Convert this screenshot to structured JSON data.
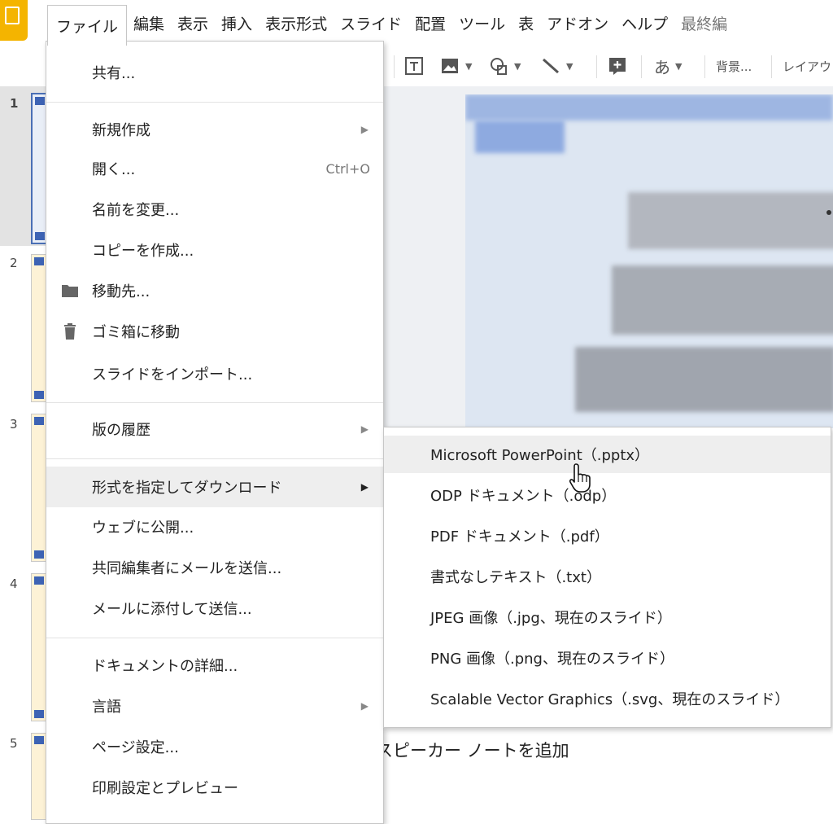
{
  "menubar": {
    "items": [
      "ファイル",
      "編集",
      "表示",
      "挿入",
      "表示形式",
      "スライド",
      "配置",
      "ツール",
      "表",
      "アドオン",
      "ヘルプ"
    ],
    "last_edit_label": "最終編"
  },
  "toolbar": {
    "text_button": "あ",
    "background_button": "背景...",
    "layout_button": "レイアウ"
  },
  "filmstrip": {
    "slide_numbers": [
      "1",
      "2",
      "3",
      "4",
      "5"
    ]
  },
  "file_menu": {
    "share": "共有...",
    "new": "新規作成",
    "open": "開く...",
    "open_shortcut": "Ctrl+O",
    "rename": "名前を変更...",
    "make_copy": "コピーを作成...",
    "move_to": "移動先...",
    "move_to_trash": "ゴミ箱に移動",
    "import_slides": "スライドをインポート...",
    "version_history": "版の履歴",
    "download_as": "形式を指定してダウンロード",
    "publish_to_web": "ウェブに公開...",
    "email_collaborators": "共同編集者にメールを送信...",
    "email_as_attachment": "メールに添付して送信...",
    "document_details": "ドキュメントの詳細...",
    "language": "言語",
    "page_setup": "ページ設定...",
    "print_preview": "印刷設定とプレビュー"
  },
  "download_submenu": {
    "items": [
      "Microsoft PowerPoint（.pptx）",
      "ODP ドキュメント（.odp）",
      "PDF ドキュメント（.pdf）",
      "書式なしテキスト（.txt）",
      "JPEG 画像（.jpg、現在のスライド）",
      "PNG 画像（.png、現在のスライド）",
      "Scalable Vector Graphics（.svg、現在のスライド）"
    ],
    "highlighted_index": 0
  },
  "speaker_notes": {
    "placeholder": "スピーカー ノートを追加",
    "visible_text": "スピーカー ノートを追加"
  },
  "colors": {
    "logo": "#f4b400",
    "menu_highlight": "#eeeeee",
    "slide_marker": "#3d63b4",
    "thumb_fill": "#fdf2d6"
  }
}
